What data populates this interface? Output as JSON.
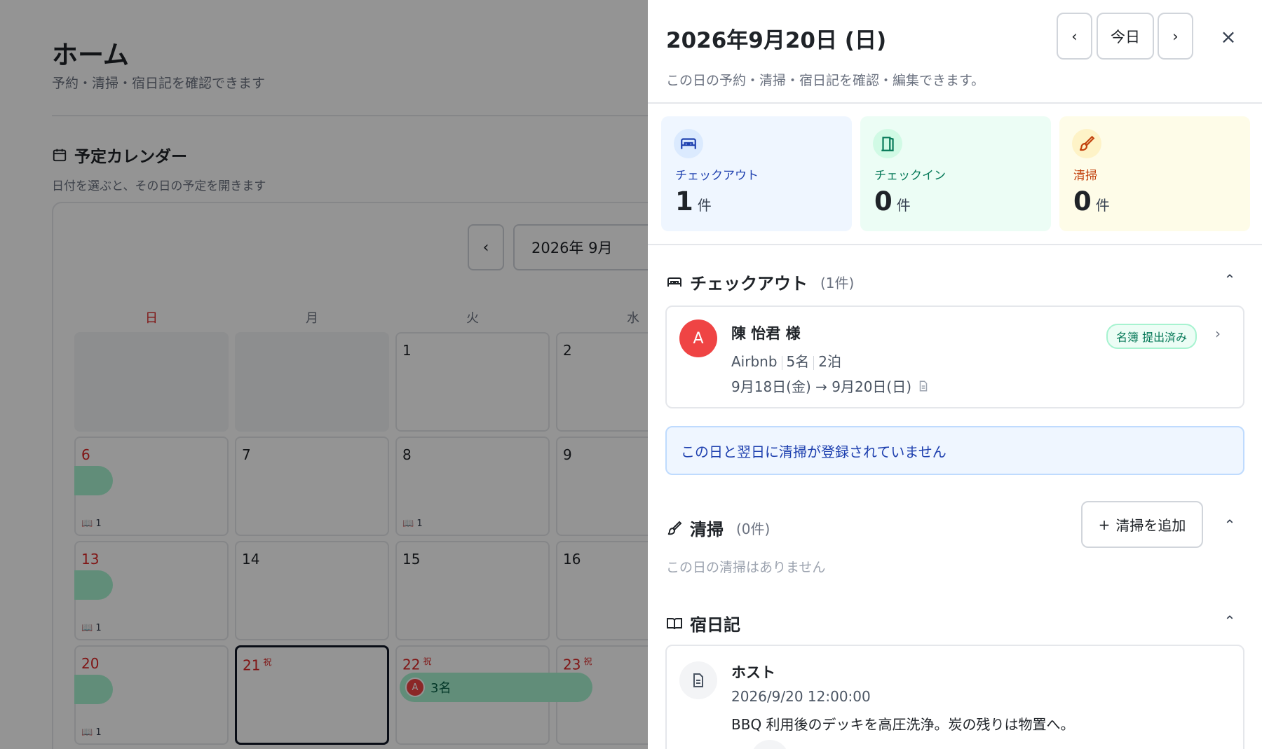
{
  "background": {
    "title": "ホーム",
    "subtitle": "予約・清掃・宿日記を確認できます",
    "calendar_heading": "予定カレンダー",
    "calendar_sub": "日付を選ぶと、その日の予定を開きます",
    "month_label": "2026年 9月",
    "weekdays": [
      "日",
      "月",
      "火",
      "水"
    ],
    "cells": {
      "d1": "1",
      "d2": "2",
      "d6": "6",
      "d7": "7",
      "d8": "8",
      "d9": "9",
      "d13": "13",
      "d14": "14",
      "d15": "15",
      "d16": "16",
      "d20": "20",
      "d21": "21",
      "d22": "22",
      "d23": "23"
    },
    "holiday_mark": "祝",
    "diary_counts": {
      "d6": "1",
      "d8": "1",
      "d13": "1",
      "d20": "1"
    },
    "booking_bar": {
      "avatar": "A",
      "label": "3名"
    }
  },
  "panel": {
    "title": "2026年9月20日 (日)",
    "subtitle": "この日の予約・清掃・宿日記を確認・編集できます。",
    "nav": {
      "prev": "‹",
      "today": "今日",
      "next": "›",
      "close": "×"
    },
    "stats": [
      {
        "label": "チェックアウト",
        "count": "1",
        "unit": "件",
        "color": "#1e40af"
      },
      {
        "label": "チェックイン",
        "count": "0",
        "unit": "件",
        "color": "#047857"
      },
      {
        "label": "清掃",
        "count": "0",
        "unit": "件",
        "color": "#c2410c"
      }
    ],
    "checkout": {
      "heading": "チェックアウト",
      "count": "(1件)",
      "reservation": {
        "avatar": "A",
        "name": "陳 怡君 様",
        "channel": "Airbnb",
        "guests": "5名",
        "nights": "2泊",
        "dates": "9月18日(金) → 9月20日(日)",
        "badge": "名簿 提出済み"
      }
    },
    "alert": "この日と翌日に清掃が登録されていません",
    "cleaning": {
      "heading": "清掃",
      "count": "(0件)",
      "add_label": "清掃を追加",
      "empty": "この日の清掃はありません"
    },
    "diary": {
      "heading": "宿日記",
      "author": "ホスト",
      "timestamp": "2026/9/20 12:00:00",
      "body": "BBQ 利用後のデッキを高圧洗浄。炭の残りは物置へ。"
    }
  }
}
